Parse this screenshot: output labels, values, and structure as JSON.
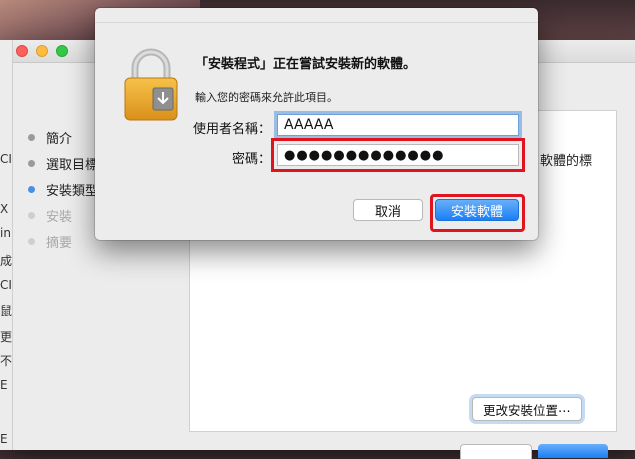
{
  "installer": {
    "steps": [
      {
        "label": "簡介",
        "state": "done"
      },
      {
        "label": "選取目標",
        "state": "done"
      },
      {
        "label": "安裝類型",
        "state": "current"
      },
      {
        "label": "安裝",
        "state": "future"
      },
      {
        "label": "摘要",
        "state": "future"
      }
    ],
    "behind_text": "軟體的標",
    "change_location_label": "更改安裝位置⋯"
  },
  "left_strip_glyphs": [
    "CI",
    "X",
    "in",
    "成",
    "CI",
    "鼠",
    "更",
    "不",
    "E",
    "E"
  ],
  "auth_sheet": {
    "title": "「安裝程式」正在嘗試安裝新的軟體。",
    "subtitle": "輸入您的密碼來允許此項目。",
    "username_label": "使用者名稱：",
    "username_value": "AAAAA",
    "password_label": "密碼：",
    "password_value": "●●●●●●●●●●●●●",
    "cancel_label": "取消",
    "install_label": "安裝軟體"
  },
  "colors": {
    "accent_blue": "#1b7ff5",
    "highlight_red": "#e0141e",
    "current_step_dot": "#4a90e2"
  }
}
